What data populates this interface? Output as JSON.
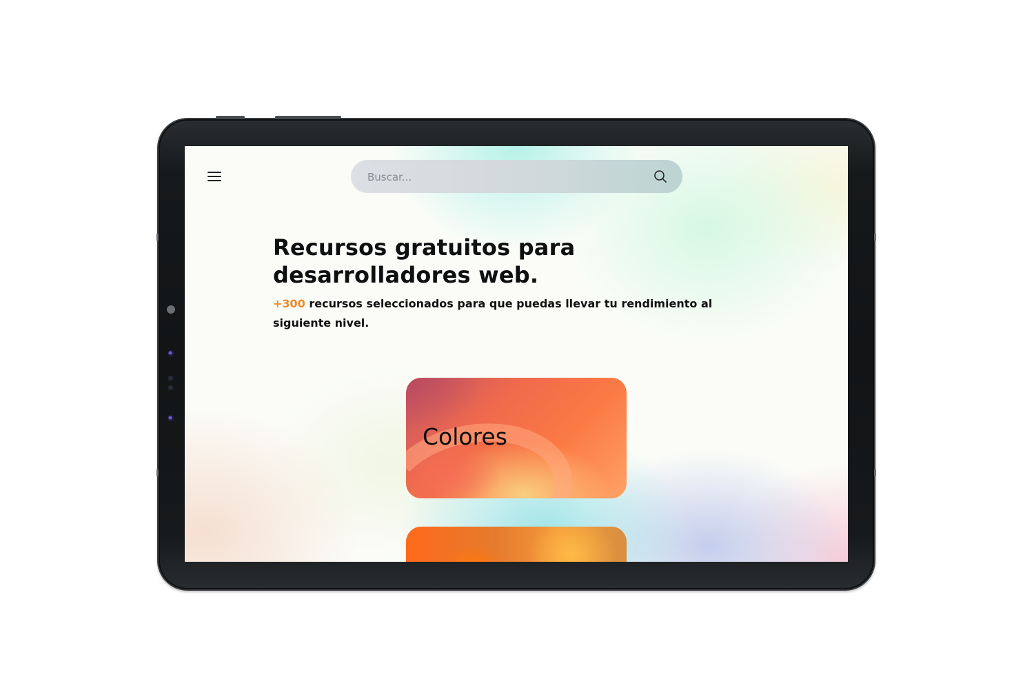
{
  "search": {
    "placeholder": "Buscar..."
  },
  "hero": {
    "title": "Recursos gratuitos para desarrolladores web.",
    "subtitle_highlight": "+300",
    "subtitle_rest": " recursos seleccionados para que puedas llevar tu rendimiento al siguiente nivel."
  },
  "cards": [
    {
      "title": "Colores"
    },
    {
      "title": ""
    }
  ],
  "icons": {
    "menu": "hamburger-menu-icon",
    "search": "magnifier-icon"
  },
  "colors": {
    "accent": "#f08a2c",
    "text": "#0d0f10",
    "device_frame": "#16191b"
  }
}
